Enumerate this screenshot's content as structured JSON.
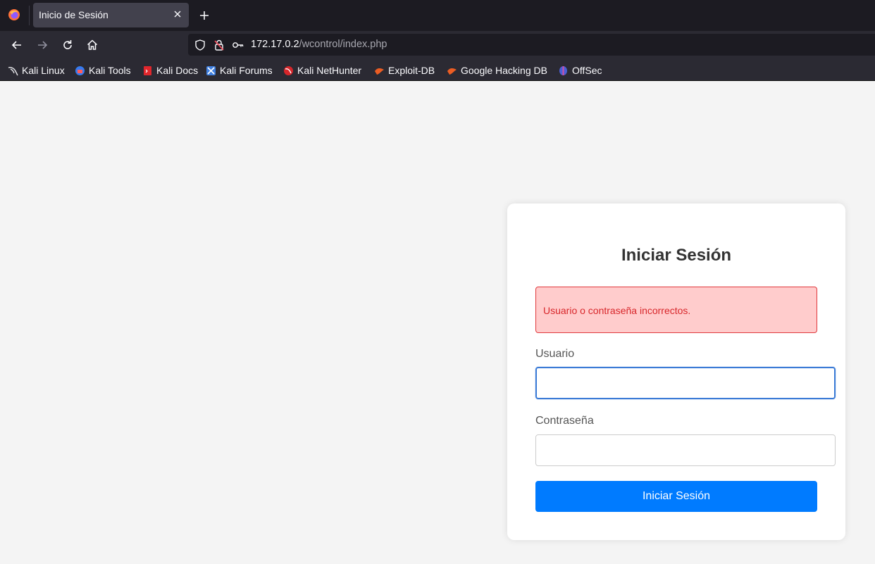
{
  "browser": {
    "tab": {
      "title": "Inicio de Sesión"
    },
    "url": {
      "host": "172.17.0.2",
      "path": "/wcontrol/index.php"
    },
    "bookmarks": [
      {
        "label": "Kali Linux",
        "icon": "kali-dragon-icon"
      },
      {
        "label": "Kali Tools",
        "icon": "kali-tools-icon"
      },
      {
        "label": "Kali Docs",
        "icon": "kali-docs-icon"
      },
      {
        "label": "Kali Forums",
        "icon": "kali-forums-icon"
      },
      {
        "label": "Kali NetHunter",
        "icon": "kali-nethunter-icon"
      },
      {
        "label": "Exploit-DB",
        "icon": "exploit-db-icon"
      },
      {
        "label": "Google Hacking DB",
        "icon": "ghdb-icon"
      },
      {
        "label": "OffSec",
        "icon": "offsec-icon"
      }
    ]
  },
  "login": {
    "title": "Iniciar Sesión",
    "error_message": "Usuario o contraseña incorrectos.",
    "username_label": "Usuario",
    "username_value": "",
    "password_label": "Contraseña",
    "password_value": "",
    "submit_label": "Iniciar Sesión"
  },
  "colors": {
    "page_background": "#f4f4f4",
    "primary_button": "#007bff",
    "error_background": "#ffcccc",
    "error_text": "#d8262a",
    "focus_border": "#3b7bd6"
  }
}
